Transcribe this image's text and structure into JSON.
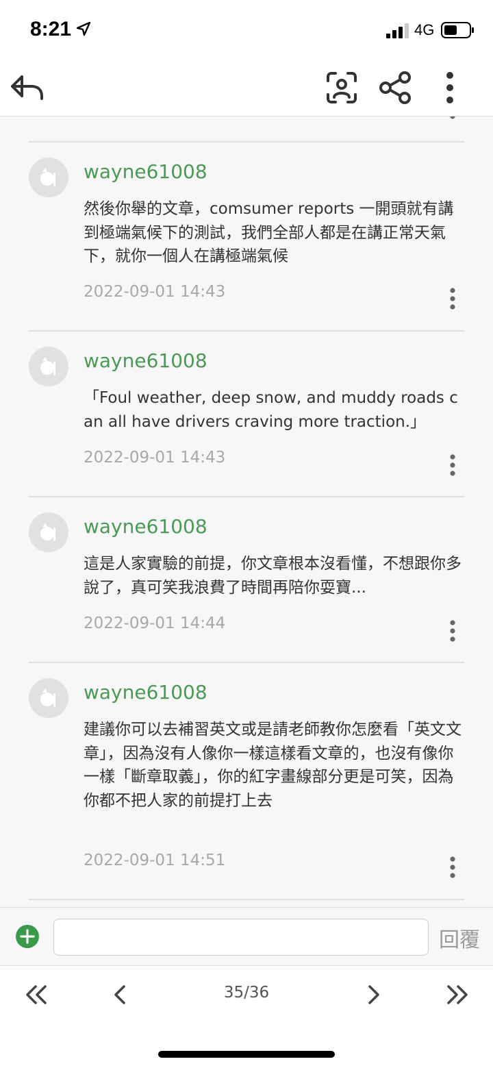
{
  "status_bar": {
    "time": "8:21",
    "network": "4G"
  },
  "comments": [
    {
      "username": "wayne61008",
      "text": "然後你舉的文章，comsumer reports 一開頭就有講到極端氣候下的測試，我們全部人都是在講正常天氣下，就你一個人在講極端氣候",
      "timestamp": "2022-09-01 14:43"
    },
    {
      "username": "wayne61008",
      "text": "「Foul weather, deep snow, and muddy roads can all have drivers craving more traction.」",
      "timestamp": "2022-09-01 14:43"
    },
    {
      "username": "wayne61008",
      "text": "這是人家實驗的前提，你文章根本沒看懂，不想跟你多說了，真可笑我浪費了時間再陪你耍寶...",
      "timestamp": "2022-09-01 14:44"
    },
    {
      "username": "wayne61008",
      "text": "建議你可以去補習英文或是請老師教你怎麼看「英文文章」，因為沒有人像你一樣這樣看文章的，也沒有像你一樣「斷章取義」，你的紅字畫線部分更是可笑，因為你都不把人家的前提打上去",
      "timestamp": "2022-09-01 14:51"
    }
  ],
  "reply_bar": {
    "input_value": "",
    "reply_label": "回覆"
  },
  "pagination": {
    "current": "35/36"
  },
  "colors": {
    "username": "#4a9a55",
    "add_button": "#3a9a4a",
    "timestamp": "#a8a8a8"
  },
  "icons": {
    "back": "reply-back-icon",
    "scan": "face-scan-icon",
    "share": "share-icon",
    "more": "more-vertical-icon",
    "add": "plus-circle-icon"
  }
}
